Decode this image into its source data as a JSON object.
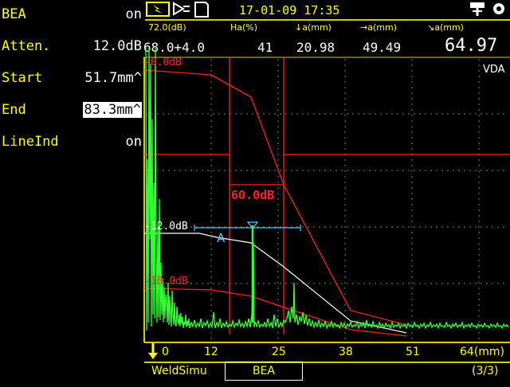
{
  "params": [
    {
      "label": "BEA",
      "value": "on",
      "selected": false
    },
    {
      "label": "Atten.",
      "value": "12.0dB",
      "selected": false
    },
    {
      "label": "Start",
      "value": "51.7mm^",
      "selected": false
    },
    {
      "label": "End",
      "value": "83.3mm^",
      "selected": true
    },
    {
      "label": "LineInd",
      "value": "on",
      "selected": false
    }
  ],
  "datetime": "17-01-09 17:35",
  "headers": [
    "72.0(dB)",
    "Ha(%)",
    "↓a(mm)",
    "→a(mm)",
    "↘a(mm)"
  ],
  "readings": [
    "68.0+4.0",
    "41",
    "20.98",
    "49.49",
    "64.97"
  ],
  "curve_mode": "VDA",
  "curve_labels": {
    "top": "-0.0dB",
    "mid": "-12.0dB",
    "low": "-18.0dB",
    "gate_db": "60.0dB",
    "gate_tag": "A"
  },
  "axis": {
    "ticks": [
      "0",
      "12",
      "25",
      "38",
      "51",
      "64(mm)"
    ]
  },
  "footer": {
    "left": "WeldSimu",
    "tab": "BEA",
    "page": "(3/3)"
  },
  "colors": {
    "accent": "#ffff00",
    "curve": "#ff2020",
    "signal": "#30ff30",
    "gate": "#40d0ff"
  }
}
